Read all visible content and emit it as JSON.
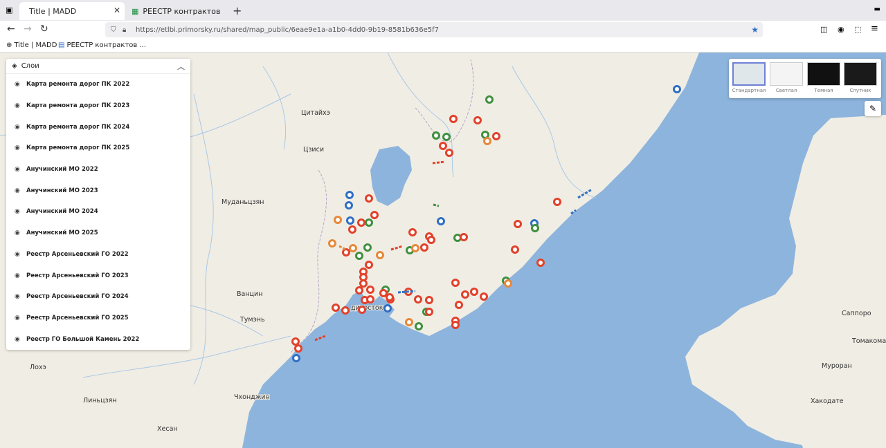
{
  "browser": {
    "tabs": [
      {
        "title": "Title | MADD"
      },
      {
        "title": "РЕЕСТР контрактов МТДХ"
      }
    ],
    "url": "https://etlbi.primorsky.ru/shared/map_public/6eae9e1a-a1b0-4dd0-9b19-8581b636e5f7",
    "bookmarks": [
      {
        "label": "Title | MADD"
      },
      {
        "label": "РЕЕСТР контрактов ..."
      }
    ]
  },
  "layers_panel": {
    "title": "Слои",
    "items": [
      {
        "label": "Карта ремонта дорог ПК 2022"
      },
      {
        "label": "Карта ремонта дорог ПК 2023"
      },
      {
        "label": "Карта ремонта дорог ПК 2024"
      },
      {
        "label": "Карта ремонта дорог ПК 2025"
      },
      {
        "label": "Анучинский МО 2022"
      },
      {
        "label": "Анучинский МО 2023"
      },
      {
        "label": "Анучинский МО 2024"
      },
      {
        "label": "Анучинский МО 2025"
      },
      {
        "label": "Реестр Арсеньевский ГО 2022"
      },
      {
        "label": "Реестр Арсеньевский ГО 2023"
      },
      {
        "label": "Реестр Арсеньевский ГО 2024"
      },
      {
        "label": "Реестр Арсеньевский ГО 2025"
      },
      {
        "label": "Реестр ГО Большой Камень 2022"
      }
    ]
  },
  "basemaps": [
    {
      "label": "Стандартная",
      "selected": true
    },
    {
      "label": "Светлая",
      "selected": false
    },
    {
      "label": "Темная",
      "selected": false
    },
    {
      "label": "Спутник",
      "selected": false
    }
  ],
  "map_labels": {
    "cities": [
      "Цитайхэ",
      "Цзиси",
      "Муданьцзян",
      "Ванцин",
      "Тумэнь",
      "Лохэ",
      "Линьцзян",
      "Чхонджин",
      "Хесан",
      "Саппоро",
      "Томакомай",
      "Муроран",
      "Хакодате",
      "дивосток"
    ]
  },
  "colors": {
    "land": "#f0ede4",
    "sea": "#8db4dc",
    "marker_red": "#e2412b",
    "marker_green": "#3f8f3f",
    "marker_blue": "#2f6fc4",
    "marker_orange": "#e7883a",
    "accent": "#6f7fd6"
  }
}
